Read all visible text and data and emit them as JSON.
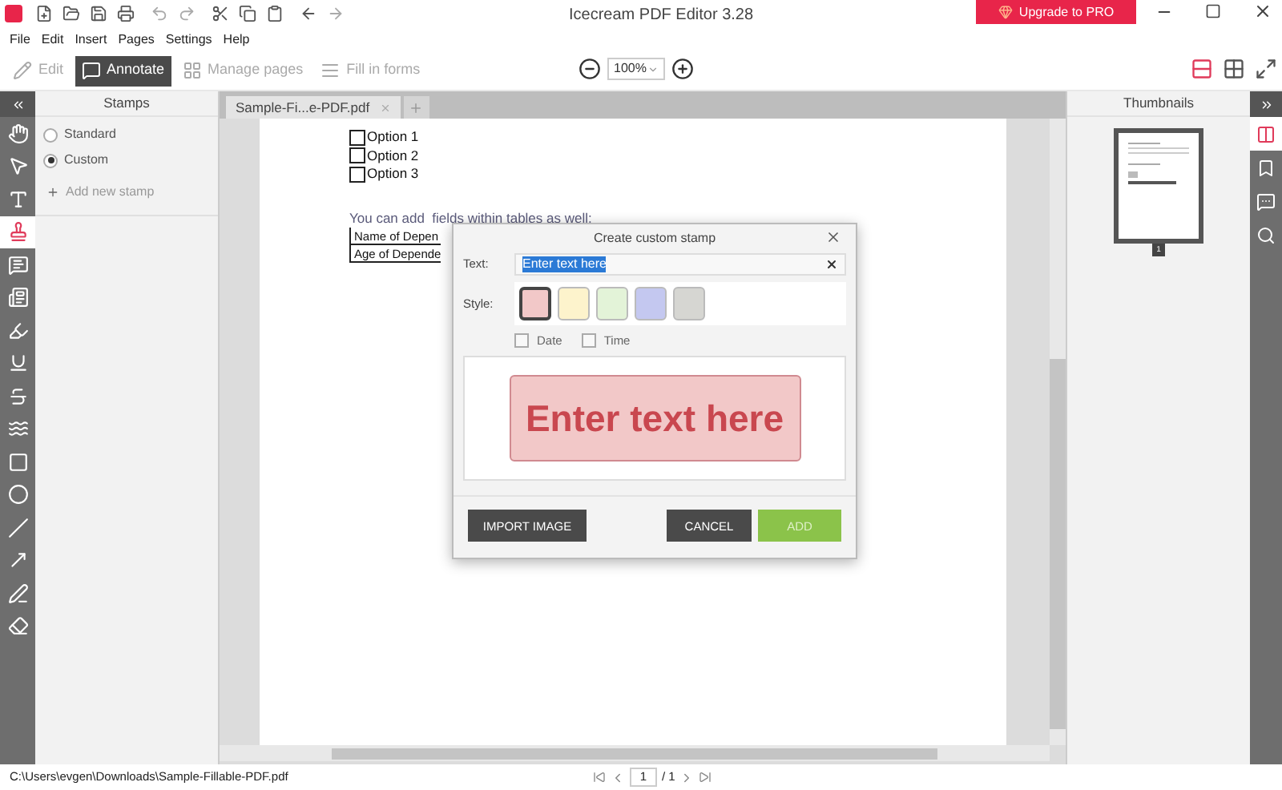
{
  "window": {
    "title": "Icecream PDF Editor 3.28",
    "upgrade_button": "Upgrade to PRO"
  },
  "menu": [
    "File",
    "Edit",
    "Insert",
    "Pages",
    "Settings",
    "Help"
  ],
  "modes": [
    {
      "kind": "edit",
      "label": "Edit",
      "selected": false
    },
    {
      "kind": "annotate",
      "label": "Annotate",
      "selected": true
    },
    {
      "kind": "pages",
      "label": "Manage pages",
      "selected": false
    },
    {
      "kind": "forms",
      "label": "Fill in forms",
      "selected": false
    }
  ],
  "zoom": {
    "value": "100%"
  },
  "views": [
    {
      "kind": "single",
      "selected": true
    },
    {
      "kind": "grid",
      "selected": false
    },
    {
      "kind": "fullscreen",
      "selected": false
    }
  ],
  "tools": [
    {
      "kind": "hand",
      "selected": false
    },
    {
      "kind": "pointer",
      "selected": false
    },
    {
      "kind": "text",
      "selected": false
    },
    {
      "kind": "stamp",
      "selected": true
    },
    {
      "kind": "comment",
      "selected": false
    },
    {
      "kind": "textbox",
      "selected": false
    },
    {
      "kind": "highlighter",
      "selected": false
    },
    {
      "kind": "underline",
      "selected": false
    },
    {
      "kind": "strike",
      "selected": false
    },
    {
      "kind": "wavy",
      "selected": false
    },
    {
      "kind": "rectangle",
      "selected": false
    },
    {
      "kind": "ellipse",
      "selected": false
    },
    {
      "kind": "line",
      "selected": false
    },
    {
      "kind": "arrow",
      "selected": false
    },
    {
      "kind": "pencil",
      "selected": false
    },
    {
      "kind": "eraser",
      "selected": false
    }
  ],
  "stamps_panel": {
    "title": "Stamps",
    "options": [
      {
        "label": "Standard",
        "selected": false
      },
      {
        "label": "Custom",
        "selected": true
      }
    ],
    "add_link": "Add new stamp"
  },
  "document": {
    "tab": "Sample-Fi...e-PDF.pdf",
    "options": [
      {
        "label": "Option 1",
        "checked": false
      },
      {
        "label": "Option 2",
        "checked": false
      },
      {
        "label": "Option 3",
        "checked": false
      }
    ],
    "sentence": "You can add  fields within tables as well:",
    "table_rows": [
      "Name of Depen",
      "Age of Depende"
    ]
  },
  "dialog": {
    "title": "Create custom stamp",
    "text_label": "Text:",
    "text_value": "Enter text here",
    "style_label": "Style:",
    "styles": [
      {
        "color": "#f2c8c8",
        "selected": true
      },
      {
        "color": "#fdf3cc",
        "selected": false
      },
      {
        "color": "#e3f3d8",
        "selected": false
      },
      {
        "color": "#c4c8f0",
        "selected": false
      },
      {
        "color": "#d6d6d2",
        "selected": false
      }
    ],
    "checks": [
      {
        "label": "Date",
        "checked": false
      },
      {
        "label": "Time",
        "checked": false
      }
    ],
    "preview": "Enter text here",
    "import_button": "IMPORT IMAGE",
    "cancel_button": "CANCEL",
    "add_button": "ADD"
  },
  "thumbnails": {
    "title": "Thumbnails",
    "pages": [
      {
        "number": "1",
        "selected": true
      }
    ]
  },
  "right_tools": [
    {
      "kind": "pages",
      "selected": true
    },
    {
      "kind": "bookmark",
      "selected": false
    },
    {
      "kind": "comment",
      "selected": false
    },
    {
      "kind": "search",
      "selected": false
    }
  ],
  "status_bar": {
    "path": "C:\\Users\\evgen\\Downloads\\Sample-Fillable-PDF.pdf",
    "page": "1",
    "total": "/ 1"
  }
}
